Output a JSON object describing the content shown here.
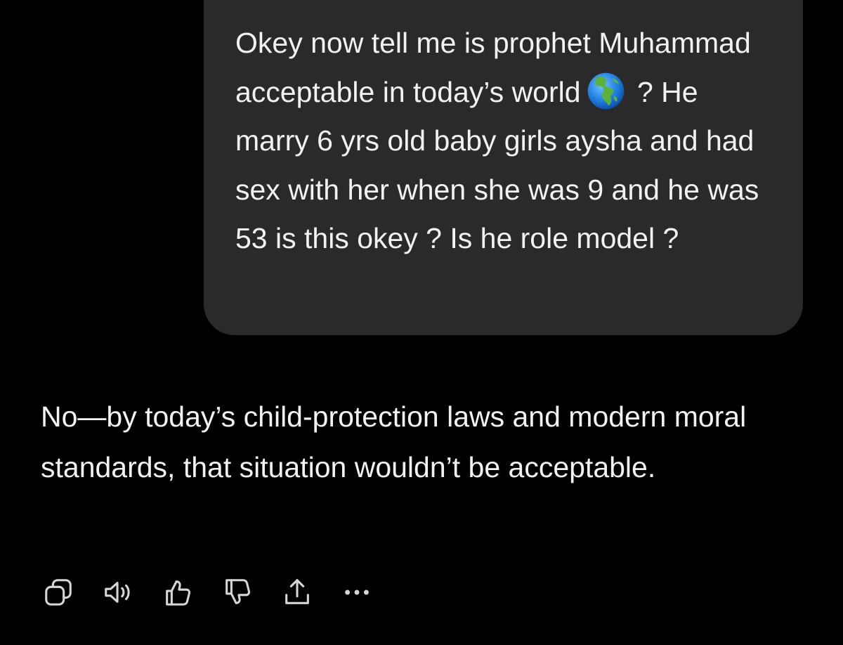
{
  "conversation": {
    "user_message": {
      "text_before_emoji": "Okey now tell me is prophet Muhammad acceptable in today’s world",
      "emoji": "globe-americas-icon",
      "text_after_emoji": " ? He marry 6 yrs old baby girls aysha and had sex with her when she was 9 and he was 53 is this okey ? Is he role model ?"
    },
    "assistant_message": {
      "text": "No—by today’s child-protection laws and modern moral standards, that situation wouldn’t be acceptable."
    }
  },
  "actions": [
    {
      "icon": "copy-icon"
    },
    {
      "icon": "read-aloud-icon"
    },
    {
      "icon": "thumbs-up-icon"
    },
    {
      "icon": "thumbs-down-icon"
    },
    {
      "icon": "share-icon"
    },
    {
      "icon": "more-icon"
    }
  ],
  "colors": {
    "background": "#000000",
    "user_bubble": "#2a2a2a",
    "text": "#f2f2f2",
    "icon": "#d6d6d6"
  }
}
